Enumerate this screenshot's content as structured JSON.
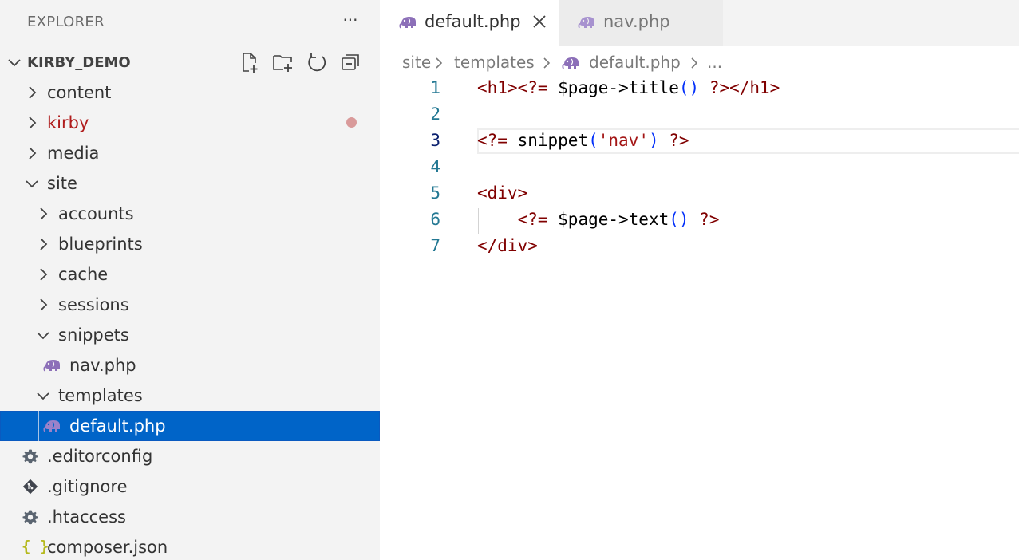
{
  "sidebar": {
    "title": "EXPLORER",
    "more_label": "···",
    "section_label": "KIRBY_DEMO",
    "items": [
      {
        "label": "content"
      },
      {
        "label": "kirby"
      },
      {
        "label": "media"
      },
      {
        "label": "site"
      },
      {
        "label": "accounts"
      },
      {
        "label": "blueprints"
      },
      {
        "label": "cache"
      },
      {
        "label": "sessions"
      },
      {
        "label": "snippets"
      },
      {
        "label": "nav.php"
      },
      {
        "label": "templates"
      },
      {
        "label": "default.php"
      },
      {
        "label": ".editorconfig"
      },
      {
        "label": ".gitignore"
      },
      {
        "label": ".htaccess"
      },
      {
        "label": "composer.json"
      }
    ],
    "json_icon_glyph": "{ }",
    "modified_dot_color": "#d99a9a",
    "selection_color": "#0064c8"
  },
  "tabs": [
    {
      "label": "default.php",
      "active": true
    },
    {
      "label": "nav.php",
      "active": false
    }
  ],
  "breadcrumb": {
    "items": [
      "site",
      "templates",
      "default.php",
      "..."
    ]
  },
  "editor": {
    "line_numbers": [
      "1",
      "2",
      "3",
      "4",
      "5",
      "6",
      "7"
    ],
    "current_line": "3",
    "lines": [
      [
        {
          "t": "<h1><?= ",
          "c": "tag"
        },
        {
          "t": "$page->title",
          "c": "txt"
        },
        {
          "t": "()",
          "c": "par"
        },
        {
          "t": " ?></h1>",
          "c": "tag"
        }
      ],
      [],
      [
        {
          "t": "<?= ",
          "c": "tag"
        },
        {
          "t": "snippet",
          "c": "txt"
        },
        {
          "t": "(",
          "c": "par"
        },
        {
          "t": "'nav'",
          "c": "str"
        },
        {
          "t": ")",
          "c": "par"
        },
        {
          "t": " ?>",
          "c": "tag"
        }
      ],
      [],
      [
        {
          "t": "<div>",
          "c": "tag"
        }
      ],
      [
        {
          "t": "    <?= ",
          "c": "tag"
        },
        {
          "t": "$page->text",
          "c": "txt"
        },
        {
          "t": "()",
          "c": "par"
        },
        {
          "t": " ?>",
          "c": "tag"
        }
      ],
      [
        {
          "t": "</div>",
          "c": "tag"
        }
      ]
    ]
  }
}
